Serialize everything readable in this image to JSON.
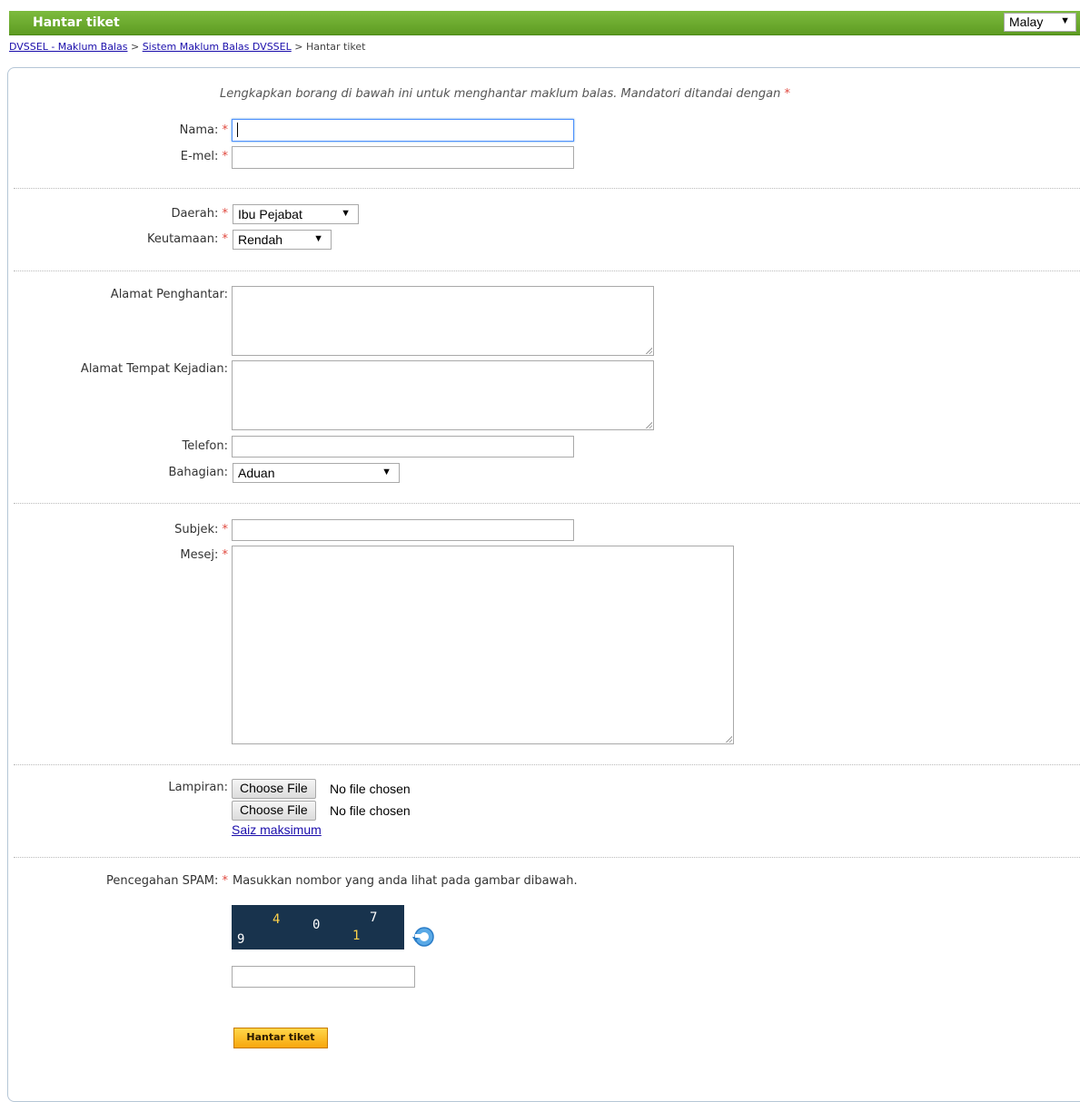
{
  "header": {
    "title": "Hantar tiket"
  },
  "language": {
    "selected": "Malay"
  },
  "breadcrumb": {
    "items": [
      "DVSSEL - Maklum Balas",
      "Sistem Maklum Balas DVSSEL"
    ],
    "separator": ">",
    "current": "Hantar tiket"
  },
  "form": {
    "intro": "Lengkapkan borang di bawah ini untuk menghantar maklum balas. Mandatori ditandai dengan",
    "required_mark": "*",
    "name_label": "Nama:",
    "email_label": "E-mel:",
    "region_label": "Daerah:",
    "region_value": "Ibu Pejabat",
    "priority_label": "Keutamaan:",
    "priority_value": "Rendah",
    "sender_address_label": "Alamat Penghantar:",
    "incident_address_label": "Alamat Tempat Kejadian:",
    "phone_label": "Telefon:",
    "division_label": "Bahagian:",
    "division_value": "Aduan",
    "subject_label": "Subjek:",
    "message_label": "Mesej:",
    "attachment_label": "Lampiran:",
    "choose_file_label": "Choose File",
    "no_file_label": "No file chosen",
    "max_size_link": "Saiz maksimum",
    "spam_label": "Pencegahan SPAM:",
    "spam_instruction": "Masukkan nombor yang anda lihat pada gambar dibawah.",
    "captcha_digits": [
      "4",
      "0",
      "7",
      "9",
      "1"
    ],
    "submit_label": "Hantar tiket"
  },
  "colors": {
    "header_green": "#6aa82e",
    "required_red": "#e0483e",
    "link_blue": "#1a0dab",
    "captcha_bg": "#18334d",
    "submit_orange": "#f7a60c"
  }
}
